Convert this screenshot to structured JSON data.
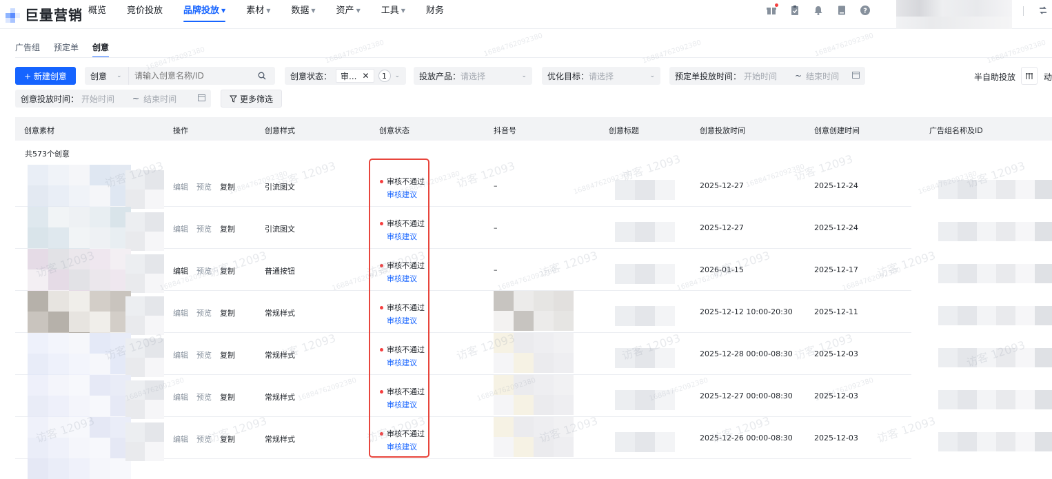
{
  "app": {
    "logo_text": "巨量营销"
  },
  "nav": [
    {
      "label": "概览",
      "has_caret": false
    },
    {
      "label": "竞价投放",
      "has_caret": false
    },
    {
      "label": "品牌投放",
      "has_caret": true,
      "active": true
    },
    {
      "label": "素材",
      "has_caret": true
    },
    {
      "label": "数据",
      "has_caret": true
    },
    {
      "label": "资产",
      "has_caret": true
    },
    {
      "label": "工具",
      "has_caret": true
    },
    {
      "label": "财务",
      "has_caret": false
    }
  ],
  "top_icons": [
    "gift-icon",
    "clipboard-icon",
    "bell-icon",
    "document-icon",
    "help-icon"
  ],
  "tabs": [
    "广告组",
    "预定单",
    "创意"
  ],
  "active_tab": "创意",
  "toolbar": {
    "new_button": "+ 新建创意",
    "search_scope": "创意",
    "search_placeholder": "请输入创意名称/ID",
    "status_label": "创意状态：",
    "status_tag": "审...",
    "status_count": "1",
    "product_label": "投放产品：",
    "product_placeholder": "请选择",
    "goal_label": "优化目标：",
    "goal_placeholder": "请选择",
    "booking_time_label": "预定单投放时间：",
    "start_placeholder": "开始时间",
    "end_placeholder": "结束时间",
    "semi_auto": "半自助投放",
    "creative_time_label": "创意投放时间：",
    "more_filters": "更多筛选"
  },
  "table": {
    "columns": [
      "创意素材",
      "操作",
      "创意样式",
      "创意状态",
      "抖音号",
      "创意标题",
      "创意投放时间",
      "创意创建时间",
      "广告组名称及ID"
    ],
    "total": "共573个创意",
    "actions": [
      "编辑",
      "预览",
      "复制"
    ],
    "status_text": "审核不通过",
    "status_link": "审核建议",
    "rows": [
      {
        "style": "引流图文",
        "douyin": "–",
        "run_time": "2025-12-27",
        "created": "2025-12-24",
        "edit_active": false
      },
      {
        "style": "引流图文",
        "douyin": "–",
        "run_time": "2025-12-27",
        "created": "2025-12-24",
        "edit_active": false
      },
      {
        "style": "普通按钮",
        "douyin": "–",
        "run_time": "2026-01-15",
        "created": "2025-12-17",
        "edit_active": true
      },
      {
        "style": "常规样式",
        "douyin": "",
        "run_time": "2025-12-12 10:00-20:30",
        "created": "2025-12-11",
        "edit_active": false
      },
      {
        "style": "常规样式",
        "douyin": "",
        "run_time": "2025-12-28 00:00-08:30",
        "created": "2025-12-03",
        "edit_active": false
      },
      {
        "style": "常规样式",
        "douyin": "",
        "run_time": "2025-12-27 00:00-08:30",
        "created": "2025-12-03",
        "edit_active": false
      },
      {
        "style": "常规样式",
        "douyin": "",
        "run_time": "2025-12-26 00:00-08:30",
        "created": "2025-12-03",
        "edit_active": false
      }
    ]
  },
  "watermark": {
    "text": "访客 12093",
    "number": "16884762092380"
  },
  "colors": {
    "primary": "#1664ff",
    "error_dot": "#f53f3f",
    "highlight_border": "#e8453c"
  }
}
